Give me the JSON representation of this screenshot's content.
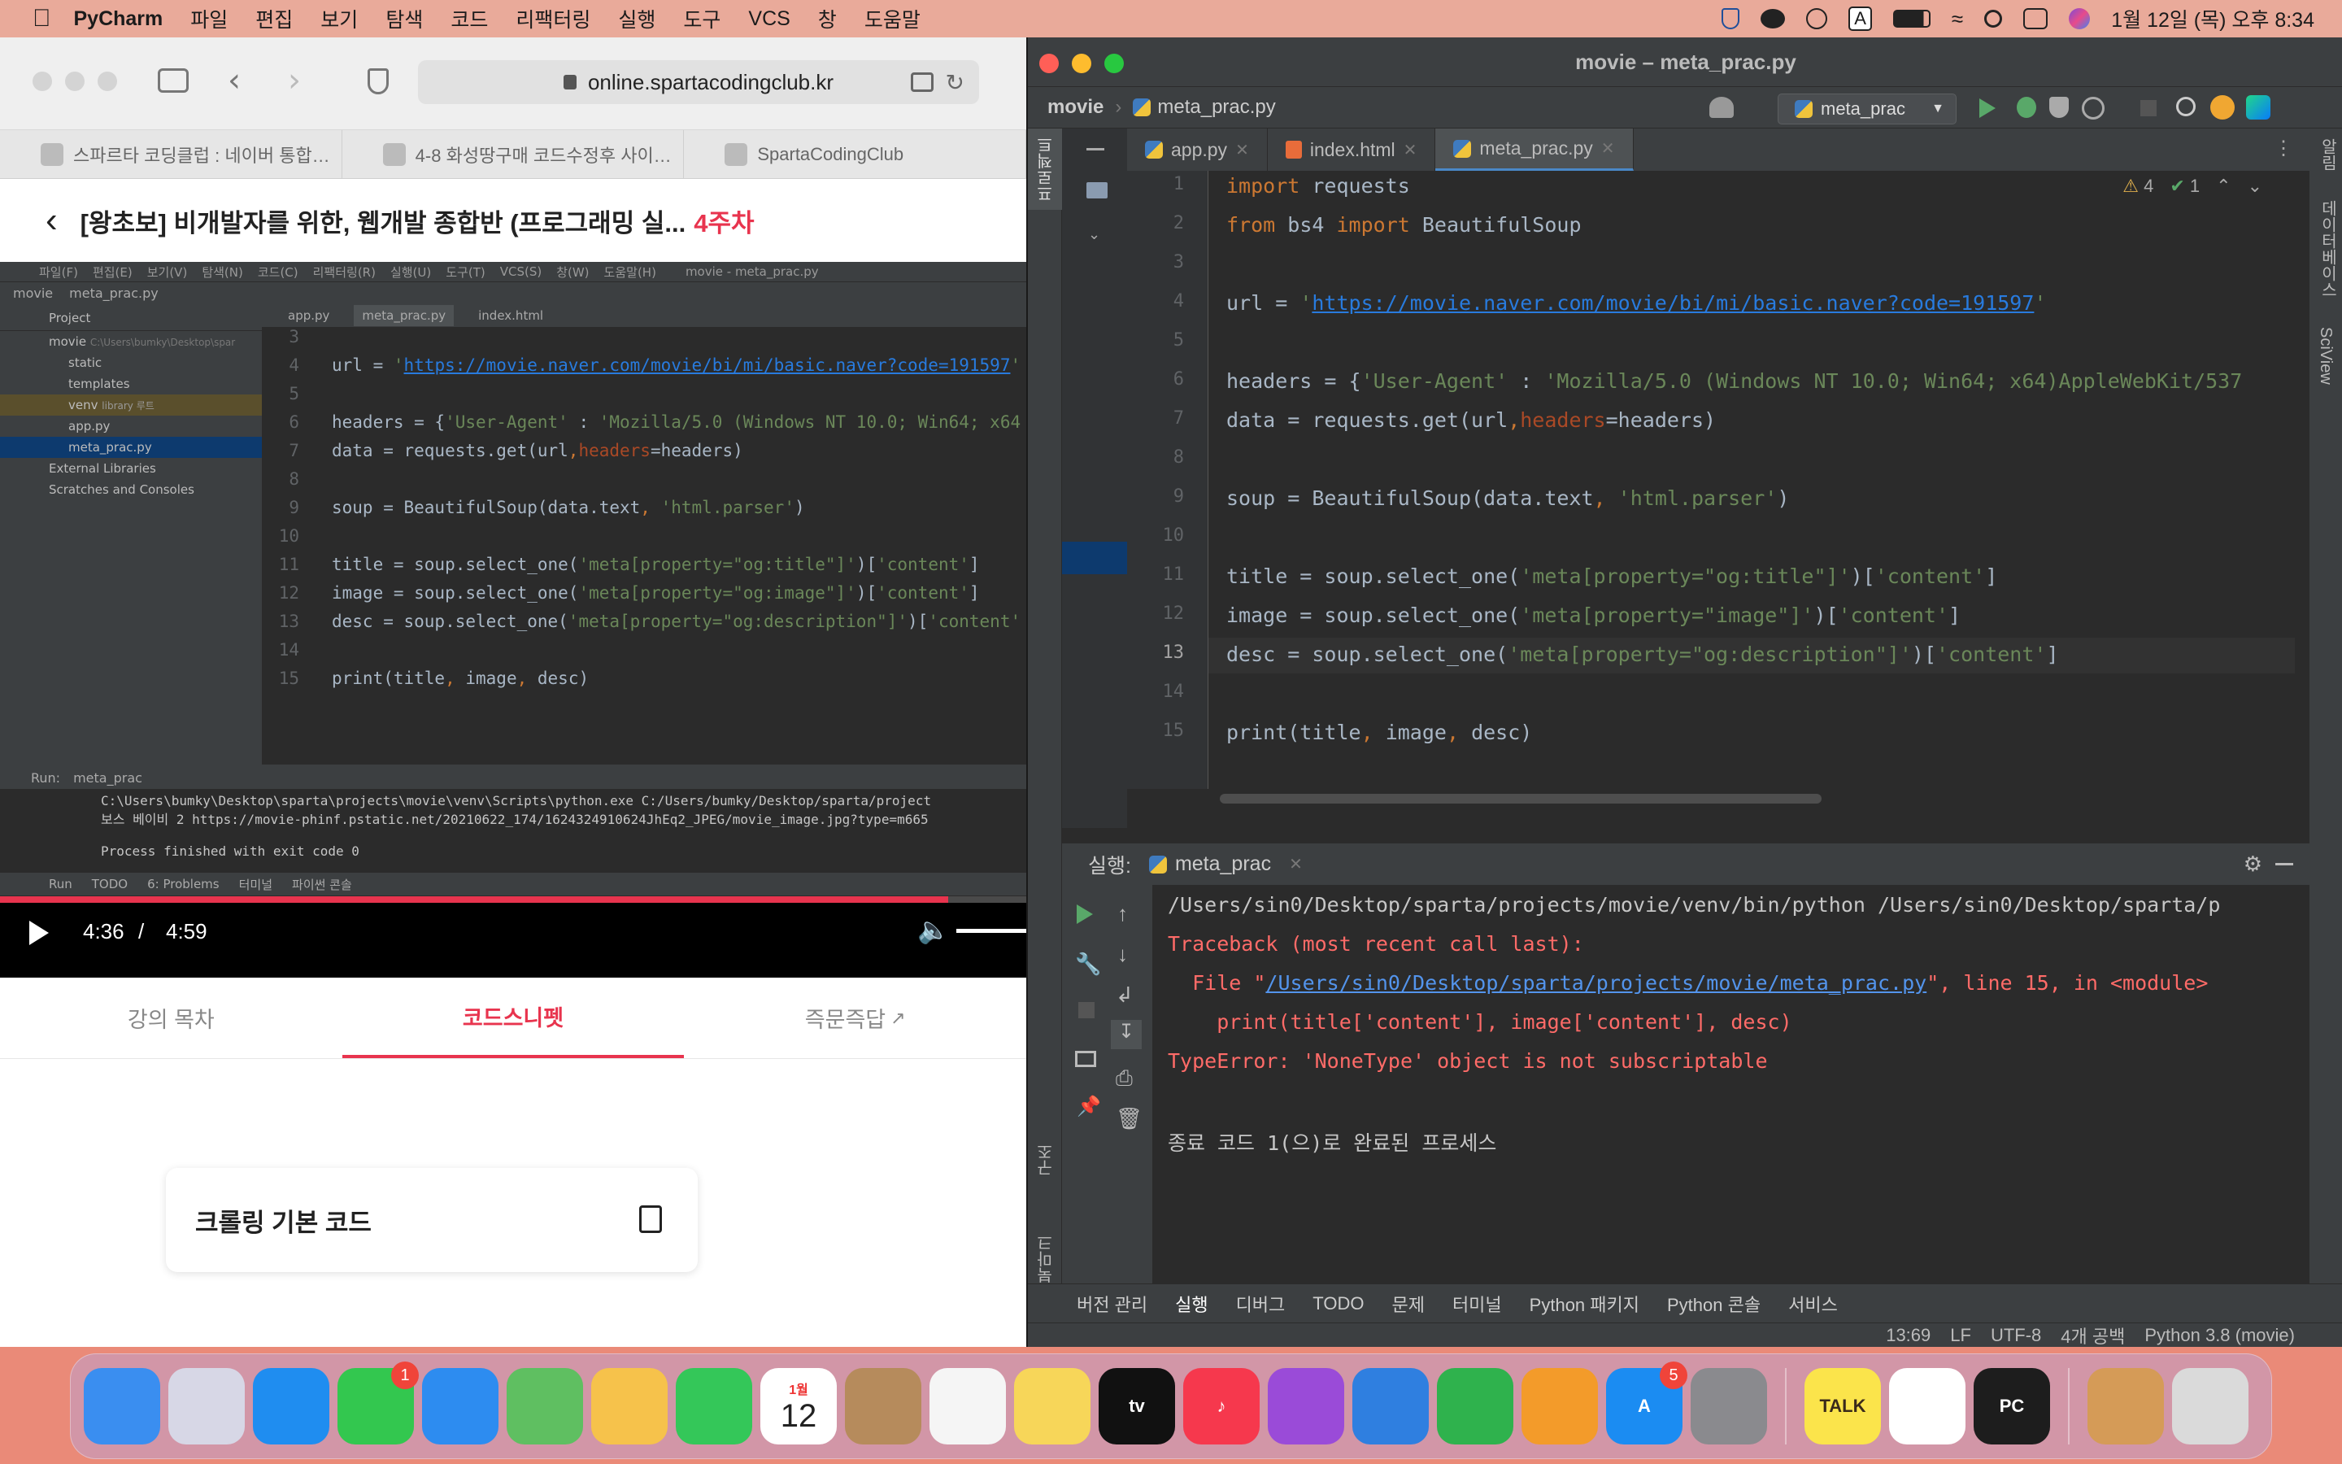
{
  "menubar": {
    "app": "PyCharm",
    "items": [
      "파일",
      "편집",
      "보기",
      "탐색",
      "코드",
      "리팩터링",
      "실행",
      "도구",
      "VCS",
      "창",
      "도움말"
    ],
    "clock": "1월 12일 (목) 오후 8:34",
    "input_source": "A"
  },
  "browser": {
    "url": "online.spartacodingclub.kr",
    "tabs": [
      "스파르타 코딩클럽 : 네이버 통합…",
      "4-8 화성땅구매 코드수정후 사이…",
      "SpartaCodingClub"
    ],
    "lecture_title": "[왕초보] 비개발자를 위한, 웹개발 종합반 (프로그래밍 실...",
    "week": "4주차",
    "video": {
      "current_time": "4:36",
      "separator": "/",
      "duration": "4:59",
      "progress": 0.924,
      "ide_title": "movie - meta_prac.py",
      "ide_menu": [
        "파일(F)",
        "편집(E)",
        "보기(V)",
        "탐색(N)",
        "코드(C)",
        "리팩터링(R)",
        "실행(U)",
        "도구(T)",
        "VCS(S)",
        "창(W)",
        "도움말(H)"
      ],
      "breadcrumb": [
        "movie",
        "meta_prac.py"
      ],
      "tabs": [
        "app.py",
        "meta_prac.py",
        "index.html"
      ],
      "project_label": "Project",
      "tree": [
        {
          "label": "movie",
          "hint": "C:\\Users\\bumky\\Desktop\\spar"
        },
        {
          "label": "static",
          "hint": ""
        },
        {
          "label": "templates",
          "hint": ""
        },
        {
          "label": "venv",
          "hint": "library 루트"
        },
        {
          "label": "app.py",
          "hint": ""
        },
        {
          "label": "meta_prac.py",
          "hint": ""
        },
        {
          "label": "External Libraries",
          "hint": ""
        },
        {
          "label": "Scratches and Consoles",
          "hint": ""
        }
      ],
      "code": [
        {
          "n": "3",
          "t": ""
        },
        {
          "n": "4",
          "t": "url = 'https://movie.naver.com/movie/bi/mi/basic.naver?code=191597'"
        },
        {
          "n": "5",
          "t": ""
        },
        {
          "n": "6",
          "t": "headers = {'User-Agent' : 'Mozilla/5.0 (Windows NT 10.0; Win64; x64"
        },
        {
          "n": "7",
          "t": "data = requests.get(url,headers=headers)"
        },
        {
          "n": "8",
          "t": ""
        },
        {
          "n": "9",
          "t": "soup = BeautifulSoup(data.text, 'html.parser')"
        },
        {
          "n": "10",
          "t": ""
        },
        {
          "n": "11",
          "t": "title = soup.select_one('meta[property=\"og:title\"]')['content']"
        },
        {
          "n": "12",
          "t": "image = soup.select_one('meta[property=\"og:image\"]')['content']"
        },
        {
          "n": "13",
          "t": "desc = soup.select_one('meta[property=\"og:description\"]')['content'"
        },
        {
          "n": "14",
          "t": ""
        },
        {
          "n": "15",
          "t": "print(title, image, desc)"
        }
      ],
      "run_label": "Run:",
      "run_tab": "meta_prac",
      "run_lines": [
        "C:\\Users\\bumky\\Desktop\\sparta\\projects\\movie\\venv\\Scripts\\python.exe C:/Users/bumky/Desktop/sparta/project",
        "보스 베이비 2 https://movie-phinf.pstatic.net/20210622_174/1624324910624JhEq2_JPEG/movie_image.jpg?type=m665",
        "",
        "Process finished with exit code 0"
      ],
      "bottom_tabs": [
        "Run",
        "TODO",
        "6: Problems",
        "터미널",
        "파이썬 콘솔"
      ]
    },
    "lower_tabs": [
      "강의 목차",
      "코드스니펫",
      "즉문즉답"
    ],
    "snippet_title": "크롤링 기본 코드"
  },
  "pycharm": {
    "window_title": "movie – meta_prac.py",
    "breadcrumb": [
      "movie",
      "meta_prac.py"
    ],
    "run_config": "meta_prac",
    "editor_tabs": [
      {
        "label": "app.py",
        "active": false
      },
      {
        "label": "index.html",
        "active": false
      },
      {
        "label": "meta_prac.py",
        "active": true
      }
    ],
    "inspection": {
      "warnings": "4",
      "ok": "1"
    },
    "left_tool": "프로젝트",
    "right_tools": [
      "알림",
      "데이터베이스",
      "SciView"
    ],
    "left_bottom_tools": [
      "구조",
      "북마크"
    ],
    "code_lines": [
      "import requests",
      "from bs4 import BeautifulSoup",
      "",
      "url = 'https://movie.naver.com/movie/bi/mi/basic.naver?code=191597'",
      "",
      "headers = {'User-Agent' : 'Mozilla/5.0 (Windows NT 10.0; Win64; x64)AppleWebKit/537",
      "data = requests.get(url,headers=headers)",
      "",
      "soup = BeautifulSoup(data.text, 'html.parser')",
      "",
      "title = soup.select_one('meta[property=\"og:title\"]')['content']",
      "image = soup.select_one('meta[property=\"image\"]')['content']",
      "desc = soup.select_one('meta[property=\"og:description\"]')['content']",
      "",
      "print(title, image, desc)"
    ],
    "current_line": 13,
    "run": {
      "label": "실행:",
      "tab": "meta_prac",
      "lines": [
        {
          "kind": "n",
          "text": "/Users/sin0/Desktop/sparta/projects/movie/venv/bin/python /Users/sin0/Desktop/sparta/p"
        },
        {
          "kind": "e",
          "text": "Traceback (most recent call last):"
        },
        {
          "kind": "e",
          "pre": "  File \"",
          "link": "/Users/sin0/Desktop/sparta/projects/movie/meta_prac.py",
          "post": "\", line 15, in <module>"
        },
        {
          "kind": "e",
          "text": "    print(title['content'], image['content'], desc)"
        },
        {
          "kind": "e",
          "text": "TypeError: 'NoneType' object is not subscriptable"
        },
        {
          "kind": "n",
          "text": ""
        },
        {
          "kind": "n",
          "text": "종료 코드 1(으)로 완료된 프로세스"
        }
      ]
    },
    "bottom_tools": [
      "버전 관리",
      "실행",
      "디버그",
      "TODO",
      "문제",
      "터미널",
      "Python 패키지",
      "Python 콘솔",
      "서비스"
    ],
    "status": [
      "13:69",
      "LF",
      "UTF-8",
      "4개 공백",
      "Python 3.8 (movie)"
    ]
  },
  "dock": {
    "apps": [
      {
        "name": "Finder",
        "color": "#3a8ef0",
        "label": ""
      },
      {
        "name": "Launchpad",
        "color": "#d7d7e6",
        "label": ""
      },
      {
        "name": "Safari",
        "color": "#1f8df0",
        "label": ""
      },
      {
        "name": "Messages",
        "color": "#33c74f",
        "label": "",
        "badge": "1"
      },
      {
        "name": "Mail",
        "color": "#2d8cf0",
        "label": ""
      },
      {
        "name": "Maps",
        "color": "#5fbf61",
        "label": ""
      },
      {
        "name": "Photos",
        "color": "#f6c24b",
        "label": ""
      },
      {
        "name": "FaceTime",
        "color": "#34c759",
        "label": ""
      },
      {
        "name": "Calendar",
        "color": "#ffffff",
        "label": "12",
        "sub": "1월"
      },
      {
        "name": "Contacts",
        "color": "#b68b5c",
        "label": ""
      },
      {
        "name": "Reminders",
        "color": "#f5f5f5",
        "label": ""
      },
      {
        "name": "Notes",
        "color": "#f7d659",
        "label": ""
      },
      {
        "name": "TV",
        "color": "#111111",
        "label": "tv"
      },
      {
        "name": "Music",
        "color": "#f6384d",
        "label": "♪"
      },
      {
        "name": "Podcasts",
        "color": "#9a4bd8",
        "label": ""
      },
      {
        "name": "Keynote",
        "color": "#2f7fe0",
        "label": ""
      },
      {
        "name": "Numbers",
        "color": "#2fb24d",
        "label": ""
      },
      {
        "name": "Pages",
        "color": "#f39b2a",
        "label": ""
      },
      {
        "name": "App Store",
        "color": "#1b8cf2",
        "label": "A",
        "badge": "5"
      },
      {
        "name": "System Settings",
        "color": "#8a8a8e",
        "label": ""
      }
    ],
    "apps2": [
      {
        "name": "KakaoTalk",
        "color": "#fbe44b",
        "label": "TALK"
      },
      {
        "name": "Chrome",
        "color": "#ffffff",
        "label": ""
      },
      {
        "name": "PyCharm",
        "color": "#1d1d1d",
        "label": "PC"
      }
    ],
    "apps3": [
      {
        "name": "Archive",
        "color": "#d59b57",
        "label": ""
      },
      {
        "name": "Trash",
        "color": "#dadada",
        "label": ""
      }
    ]
  }
}
